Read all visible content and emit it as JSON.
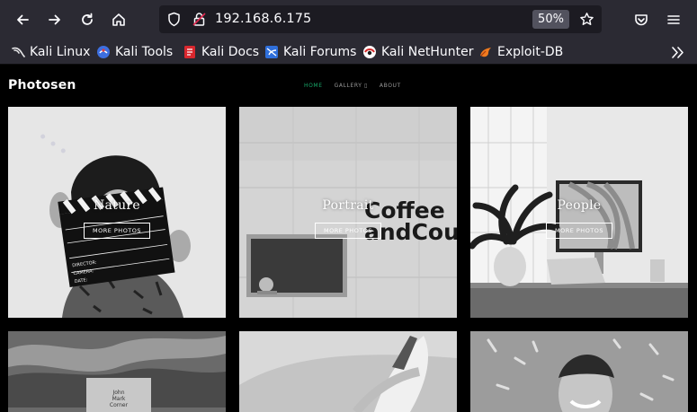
{
  "browser": {
    "url": "192.168.6.175",
    "zoom": "50%",
    "bookmarks": [
      {
        "label": "Kali Linux",
        "icon": "kali-dragon-icon"
      },
      {
        "label": "Kali Tools",
        "icon": "kali-tools-icon"
      },
      {
        "label": "Kali Docs",
        "icon": "kali-docs-icon"
      },
      {
        "label": "Kali Forums",
        "icon": "kali-forums-icon"
      },
      {
        "label": "Kali NetHunter",
        "icon": "kali-nethunter-icon"
      },
      {
        "label": "Exploit-DB",
        "icon": "exploit-db-icon"
      }
    ]
  },
  "site": {
    "logo": "Photosen",
    "nav": [
      {
        "label": "HOME",
        "active": true
      },
      {
        "label": "GALLERY ▯",
        "active": false
      },
      {
        "label": "ABOUT",
        "active": false
      }
    ],
    "gallery": [
      {
        "title": "Nature",
        "button": "MORE PHOTOS"
      },
      {
        "title": "Portrait",
        "button": "MORE PHOTOS"
      },
      {
        "title": "People",
        "button": "MORE PHOTOS"
      }
    ],
    "photo_text": {
      "coffee_sign_line1": "Coffee",
      "coffee_sign_line2": "andCoup",
      "book_line1": "John",
      "book_line2": "Mark",
      "book_line3": "Corner"
    }
  },
  "colors": {
    "chrome_bg": "#2b2a33",
    "urlbar_bg": "#1c1b22",
    "nav_active": "#18a86a",
    "page_bg": "#000000"
  }
}
